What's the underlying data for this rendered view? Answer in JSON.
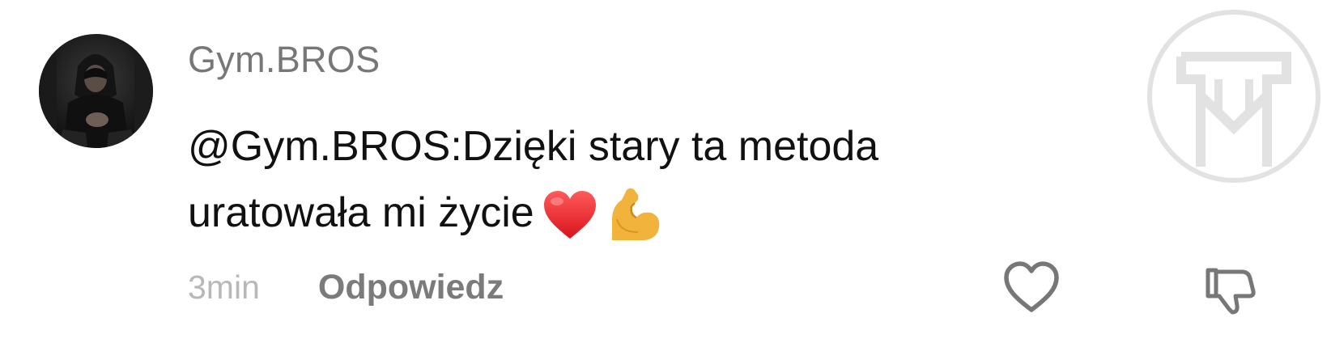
{
  "comment": {
    "author": "Gym.BROS",
    "text_line1": "@Gym.BROS:Dzięki stary ta metoda",
    "text_line2": "uratowała mi życie",
    "emojis": [
      "red-heart-emoji",
      "flexed-biceps-emoji"
    ],
    "timestamp": "3min",
    "reply_label": "Odpowiedz"
  },
  "actions": {
    "like_icon": "heart-outline-icon",
    "dislike_icon": "thumbs-down-icon"
  },
  "colors": {
    "username": "#777777",
    "text": "#111111",
    "timestamp": "#b8b8b8",
    "reply": "#7b7b7b",
    "icon": "#777777",
    "watermark": "#e2e2e2"
  }
}
